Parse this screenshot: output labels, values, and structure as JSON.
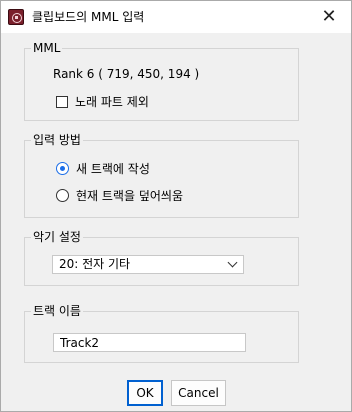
{
  "window": {
    "title": "클립보드의 MML 입력",
    "close_glyph": "✕"
  },
  "mml_group": {
    "legend": "MML",
    "rank_text": "Rank 6 ( 719, 450, 194 )",
    "exclude_vocal_label": "노래 파트 제외",
    "exclude_vocal_checked": false
  },
  "input_method_group": {
    "legend": "입력 방법",
    "options": [
      {
        "label": "새 트랙에 작성",
        "selected": true
      },
      {
        "label": "현재 트랙을 덮어씌움",
        "selected": false
      }
    ]
  },
  "instrument_group": {
    "legend": "악기 설정",
    "selected_value": "20: 전자 기타"
  },
  "track_name_group": {
    "legend": "트랙 이름",
    "value": "Track2"
  },
  "buttons": {
    "ok_label": "OK",
    "cancel_label": "Cancel"
  },
  "colors": {
    "accent": "#1c6ee8",
    "default_button_border": "#0060d0",
    "app_icon": "#7a1f2b"
  },
  "icons": {
    "app": "app-icon",
    "close": "close-icon",
    "dropdown": "chevron-down-icon"
  }
}
